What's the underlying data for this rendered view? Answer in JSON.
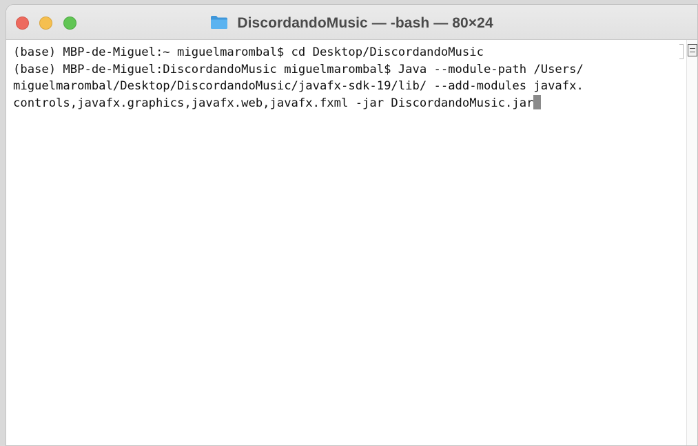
{
  "window": {
    "title": "DiscordandoMusic — -bash — 80×24",
    "folder_icon": "folder-icon",
    "colors": {
      "close": "#ed6a5e",
      "minimize": "#f5bf4f",
      "zoom": "#61c554",
      "folder": "#4aa4e6"
    }
  },
  "terminal": {
    "lines": [
      "(base) MBP-de-Miguel:~ miguelmarombal$ cd Desktop/DiscordandoMusic",
      "(base) MBP-de-Miguel:DiscordandoMusic miguelmarombal$ Java --module-path /Users/",
      "miguelmarombal/Desktop/DiscordandoMusic/javafx-sdk-19/lib/ --add-modules javafx.",
      "controls,javafx.graphics,javafx.web,javafx.fxml -jar DiscordandoMusic.jar"
    ]
  }
}
